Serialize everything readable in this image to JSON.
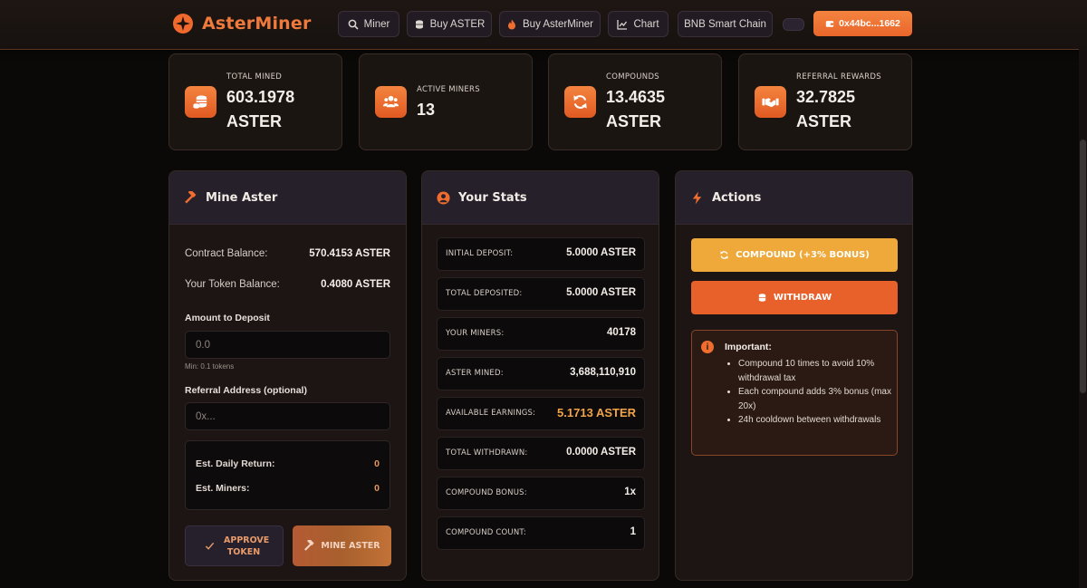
{
  "header": {
    "app_name": "AsterMiner",
    "nav": [
      {
        "label": "Miner",
        "icon": "search-icon"
      },
      {
        "label": "Buy ASTER",
        "icon": "coins-icon"
      },
      {
        "label": "Buy AsterMiner",
        "icon": "flame-icon"
      },
      {
        "label": "Chart",
        "icon": "chart-icon"
      },
      {
        "label": "BNB Smart Chain",
        "icon": ""
      }
    ],
    "wallet_label": "0x44bc...1662"
  },
  "stats": [
    {
      "label": "TOTAL MINED",
      "value": "603.1978 ASTER",
      "icon": "coins-icon"
    },
    {
      "label": "ACTIVE MINERS",
      "value": "13",
      "icon": "users-icon"
    },
    {
      "label": "COMPOUNDS",
      "value": "13.4635 ASTER",
      "icon": "refresh-icon"
    },
    {
      "label": "REFERRAL REWARDS",
      "value": "32.7825 ASTER",
      "icon": "handshake-icon"
    }
  ],
  "mine": {
    "title": "Mine Aster",
    "contract_balance_label": "Contract Balance:",
    "contract_balance_value": "570.4153 ASTER",
    "token_balance_label": "Your Token Balance:",
    "token_balance_value": "0.4080 ASTER",
    "amount_label": "Amount to Deposit",
    "amount_placeholder": "0.0",
    "min_hint": "Min: 0.1 tokens",
    "referral_label": "Referral Address (optional)",
    "referral_placeholder": "0x...",
    "est_daily_label": "Est. Daily Return:",
    "est_daily_value": "0",
    "est_miners_label": "Est. Miners:",
    "est_miners_value": "0",
    "approve_label": "APPROVE TOKEN",
    "mine_label": "MINE ASTER"
  },
  "your_stats": {
    "title": "Your Stats",
    "rows": [
      {
        "label": "INITIAL DEPOSIT:",
        "value": "5.0000 ASTER"
      },
      {
        "label": "TOTAL DEPOSITED:",
        "value": "5.0000 ASTER"
      },
      {
        "label": "YOUR MINERS:",
        "value": "40178"
      },
      {
        "label": "ASTER MINED:",
        "value": "3,688,110,910"
      },
      {
        "label": "AVAILABLE EARNINGS:",
        "value": "5.1713 ASTER"
      },
      {
        "label": "TOTAL WITHDRAWN:",
        "value": "0.0000 ASTER"
      },
      {
        "label": "COMPOUND BONUS:",
        "value": "1x"
      },
      {
        "label": "COMPOUND COUNT:",
        "value": "1"
      }
    ]
  },
  "actions": {
    "title": "Actions",
    "compound_label": "COMPOUND (+3% BONUS)",
    "withdraw_label": "WITHDRAW",
    "notice_icon": "i",
    "notice_title": "Important:",
    "notice_items": [
      "Compound 10 times to avoid 10% withdrawal tax",
      "Each compound adds 3% bonus (max 20x)",
      "24h cooldown between withdrawals"
    ]
  },
  "colors": {
    "accent": "#ee6d2f",
    "compound": "#efa93a",
    "withdraw": "#e8612a",
    "earnings": "#f2a449"
  }
}
